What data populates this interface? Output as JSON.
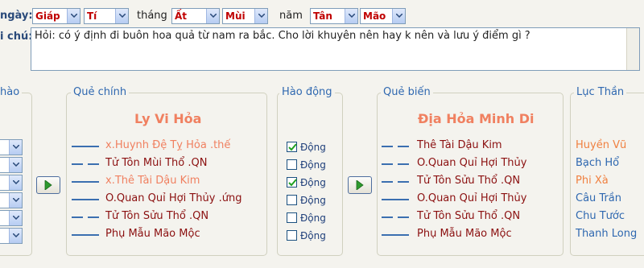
{
  "date": {
    "ngay_label": "ngày:",
    "ngay_can": "Giáp",
    "ngay_chi": "Tí",
    "thang_label": "tháng",
    "thang_can": "Ất",
    "thang_chi": "Mùi",
    "nam_label": "năm",
    "nam_can": "Tân",
    "nam_chi": "Mão"
  },
  "note": {
    "label": "i chú:",
    "text": "Hỏi: có ý định đi buôn hoa quả từ nam ra bắc. Cho lời khuyên nên hay k nên và lưu ý điểm gì ?"
  },
  "left_group": {
    "title": "hào"
  },
  "que_chinh": {
    "title": "Quẻ chính",
    "name": "Ly Vi Hỏa",
    "rows": [
      {
        "type": "yang",
        "text": "x.Huynh Đệ Tỵ Hỏa .thế",
        "color": "#f08060"
      },
      {
        "type": "yin",
        "text": "Tử Tôn Mùi Thổ .QN",
        "color": "#8b1010"
      },
      {
        "type": "yang",
        "text": "x.Thê Tài Dậu Kim",
        "color": "#f08060"
      },
      {
        "type": "yang",
        "text": "O.Quan Quỉ Hợi Thủy .ứng",
        "color": "#8b1010"
      },
      {
        "type": "yin",
        "text": "Tử Tôn Sửu Thổ .QN",
        "color": "#8b1010"
      },
      {
        "type": "yang",
        "text": "Phụ Mẫu Mão Mộc",
        "color": "#8b1010"
      }
    ]
  },
  "hao_dong": {
    "title": "Hào động",
    "items": [
      {
        "label": "Động",
        "checked": true
      },
      {
        "label": "Động",
        "checked": false
      },
      {
        "label": "Động",
        "checked": true
      },
      {
        "label": "Động",
        "checked": false
      },
      {
        "label": "Động",
        "checked": false
      },
      {
        "label": "Động",
        "checked": false
      }
    ]
  },
  "que_bien": {
    "title": "Quẻ biến",
    "name": "Địa Hỏa Minh Di",
    "rows": [
      {
        "type": "yin",
        "text": "Thê Tài Dậu Kim",
        "color": "#8b1010"
      },
      {
        "type": "yin",
        "text": "O.Quan Quỉ Hợi Thủy",
        "color": "#8b1010"
      },
      {
        "type": "yin",
        "text": "Tử Tôn Sửu Thổ .QN",
        "color": "#8b1010"
      },
      {
        "type": "yang",
        "text": "O.Quan Quỉ Hợi Thủy",
        "color": "#8b1010"
      },
      {
        "type": "yin",
        "text": "Tử Tôn Sửu Thổ .QN",
        "color": "#8b1010"
      },
      {
        "type": "yang",
        "text": "Phụ Mẫu Mão Mộc",
        "color": "#8b1010"
      }
    ]
  },
  "luc_than": {
    "title": "Lục Thần",
    "items": [
      {
        "text": "Huyền Vũ",
        "color": "#f08040"
      },
      {
        "text": "Bạch Hổ",
        "color": "#2f68b0"
      },
      {
        "text": "Phi Xà",
        "color": "#f08040"
      },
      {
        "text": "Câu Trần",
        "color": "#2f68b0"
      },
      {
        "text": "Chu Tước",
        "color": "#2f68b0"
      },
      {
        "text": "Thanh Long",
        "color": "#2f68b0"
      }
    ]
  }
}
